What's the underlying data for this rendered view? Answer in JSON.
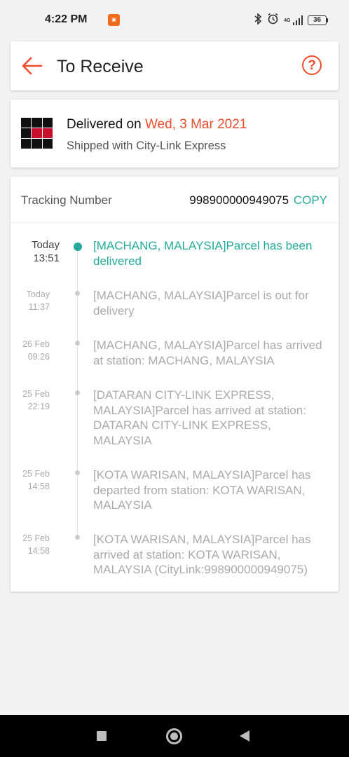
{
  "status_bar": {
    "time": "4:22 PM",
    "network": "4G",
    "battery": "36"
  },
  "header": {
    "title": "To Receive",
    "help_label": "?"
  },
  "delivery": {
    "delivered_prefix": "Delivered on ",
    "delivered_date": "Wed, 3 Mar 2021",
    "shipped_with": "Shipped with City-Link Express"
  },
  "tracking": {
    "label": "Tracking Number",
    "number": "998900000949075",
    "copy_label": "COPY",
    "events": [
      {
        "date_line1": "Today",
        "date_line2": "13:51",
        "text": "[MACHANG, MALAYSIA]Parcel has been delivered",
        "active": true
      },
      {
        "date_line1": "Today",
        "date_line2": "11:37",
        "text": "[MACHANG, MALAYSIA]Parcel is out for delivery",
        "active": false
      },
      {
        "date_line1": "26 Feb",
        "date_line2": "09:26",
        "text": "[MACHANG, MALAYSIA]Parcel has arrived at station: MACHANG, MALAYSIA",
        "active": false
      },
      {
        "date_line1": "25 Feb",
        "date_line2": "22:19",
        "text": "[DATARAN CITY-LINK EXPRESS, MALAYSIA]Parcel has arrived at station: DATARAN CITY-LINK EXPRESS, MALAYSIA",
        "active": false
      },
      {
        "date_line1": "25 Feb",
        "date_line2": "14:58",
        "text": "[KOTA WARISAN, MALAYSIA]Parcel has departed from station: KOTA WARISAN, MALAYSIA",
        "active": false
      },
      {
        "date_line1": "25 Feb",
        "date_line2": "14:58",
        "text": "[KOTA WARISAN, MALAYSIA]Parcel has arrived at station: KOTA WARISAN, MALAYSIA (CityLink:998900000949075)",
        "active": false
      }
    ]
  },
  "colors": {
    "accent": "#ee4d2d",
    "success": "#26aa99"
  },
  "icons": {
    "back": "arrow-left-icon",
    "help": "question-circle-icon",
    "bluetooth": "bluetooth-icon",
    "alarm": "alarm-icon"
  }
}
